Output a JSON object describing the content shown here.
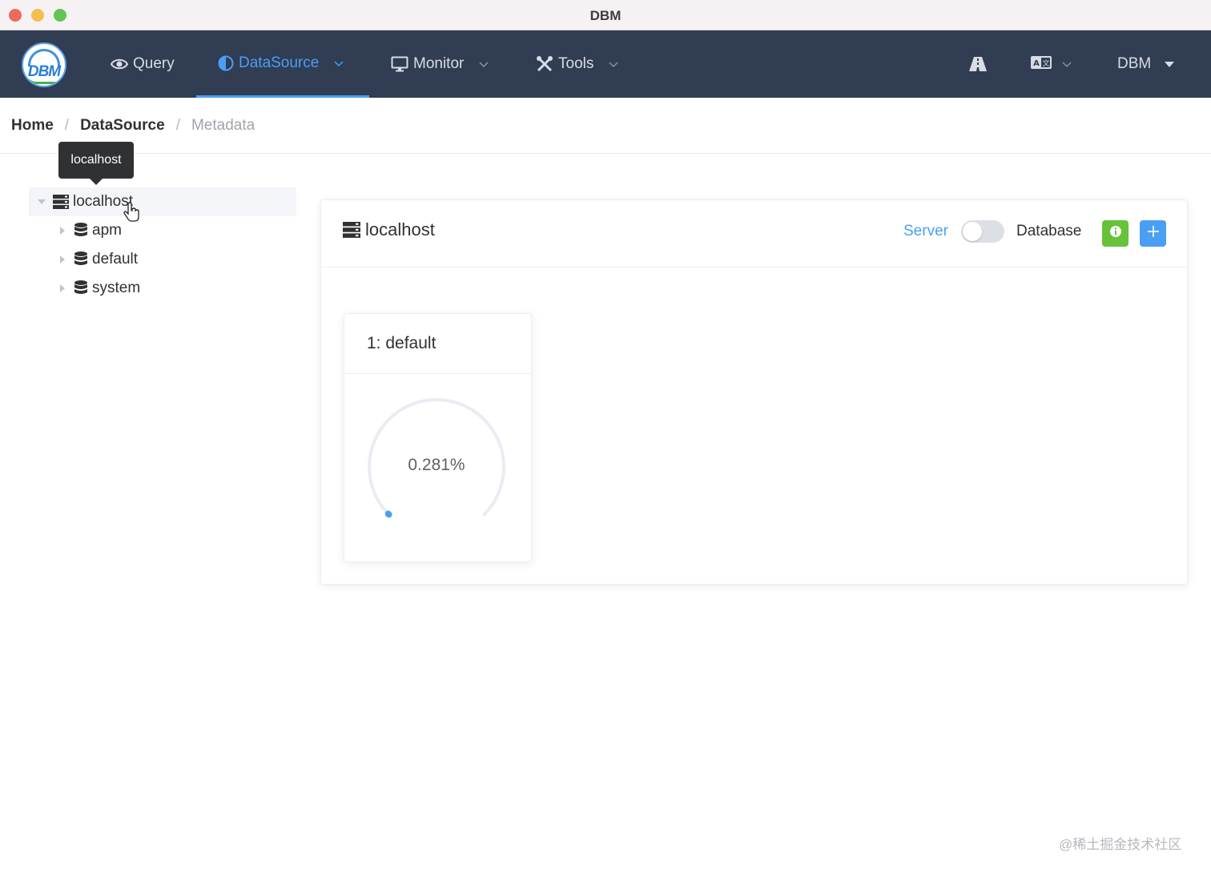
{
  "window": {
    "title": "DBM"
  },
  "nav": {
    "items": [
      {
        "label": "Query",
        "icon": "eye-icon"
      },
      {
        "label": "DataSource",
        "icon": "half-circle-icon",
        "active": true
      },
      {
        "label": "Monitor",
        "icon": "monitor-icon"
      },
      {
        "label": "Tools",
        "icon": "tools-icon"
      }
    ],
    "user_label": "DBM",
    "accent_color": "#4a9ff5",
    "background_color": "#303d52"
  },
  "breadcrumb": {
    "items": [
      "Home",
      "DataSource",
      "Metadata"
    ]
  },
  "tooltip": {
    "text": "localhost"
  },
  "tree": {
    "root": {
      "label": "localhost",
      "expanded": true
    },
    "children": [
      {
        "label": "apm"
      },
      {
        "label": "default"
      },
      {
        "label": "system"
      }
    ]
  },
  "panel": {
    "title": "localhost",
    "switch_left_label": "Server",
    "switch_right_label": "Database",
    "switch_on": false
  },
  "db_cards": [
    {
      "title": "1: default",
      "usage_text": "0.281%",
      "usage_percent": 0.281
    }
  ],
  "watermark": "@稀土掘金技术社区"
}
